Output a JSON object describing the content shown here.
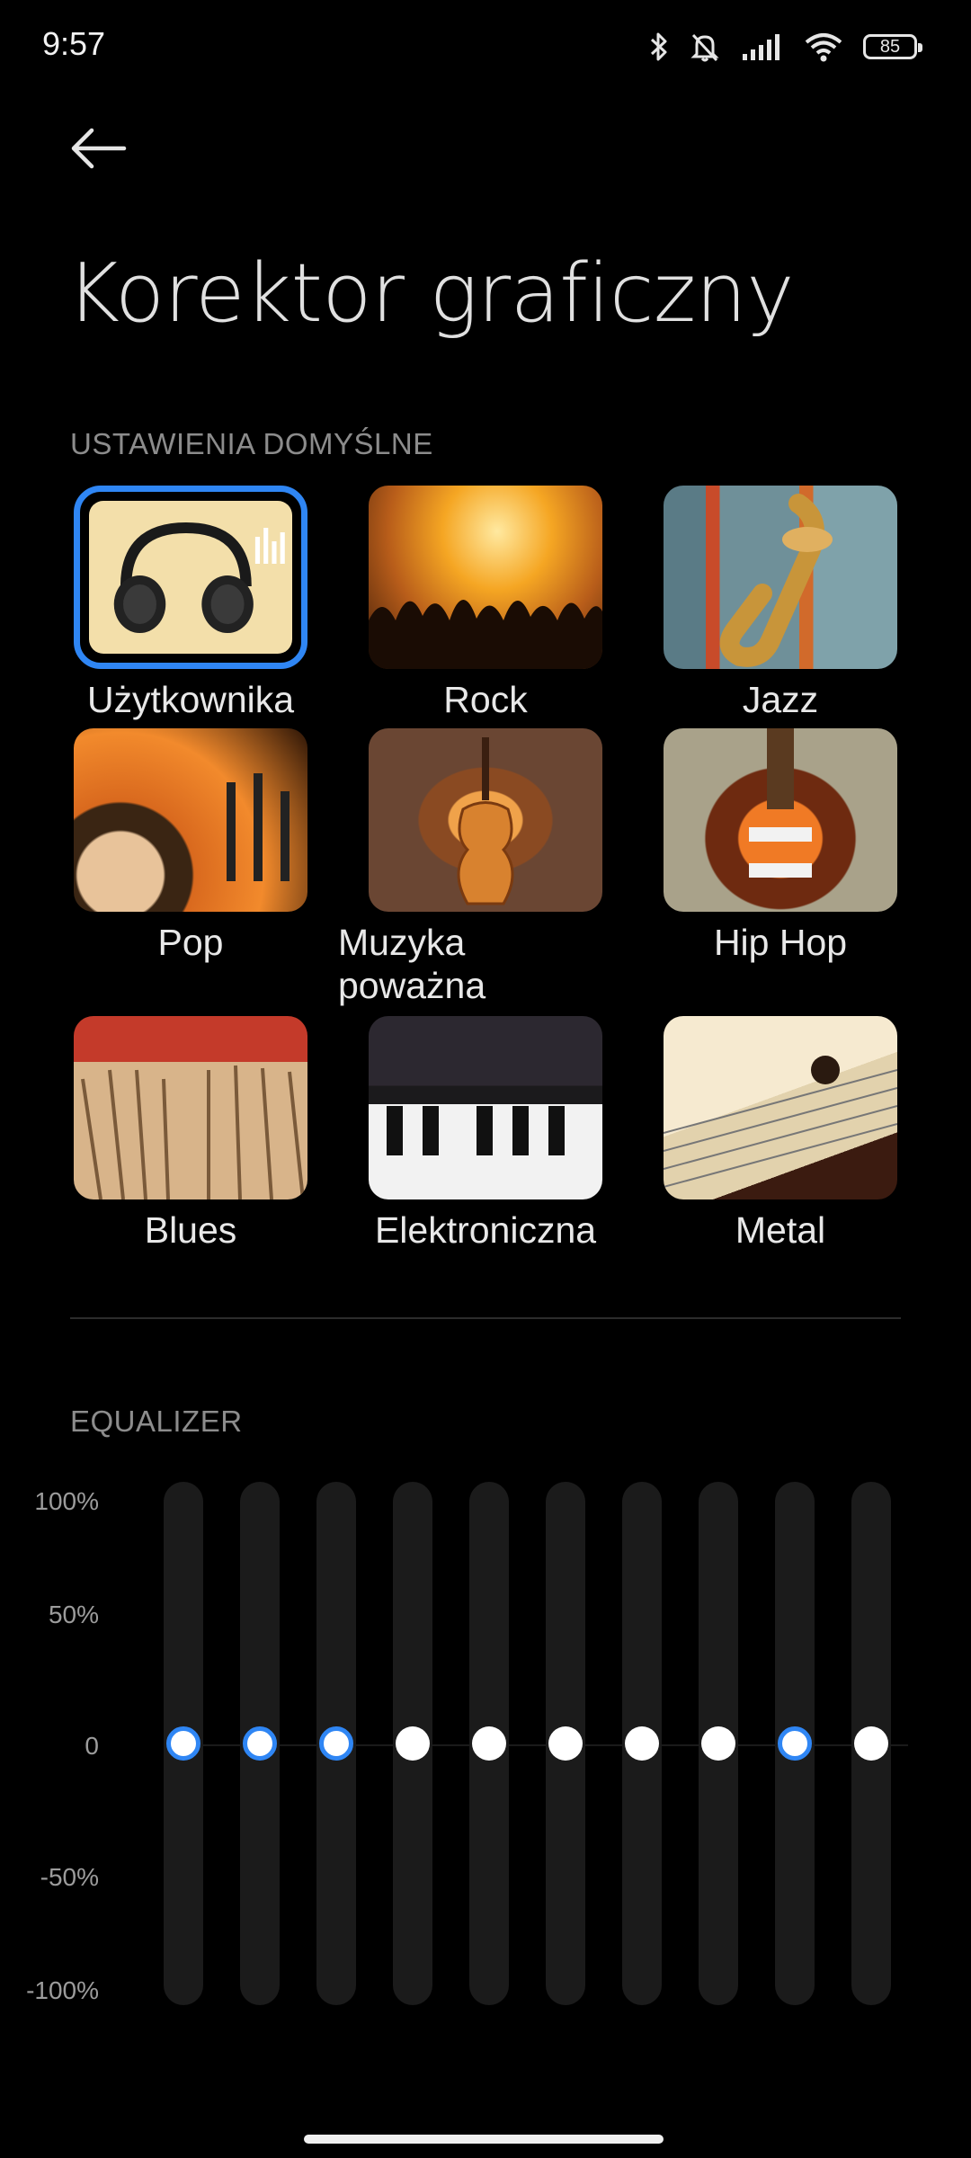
{
  "status_bar": {
    "time": "9:57",
    "battery": "85",
    "icons": [
      "bluetooth-icon",
      "bell-off-icon",
      "signal-icon",
      "wifi-icon",
      "battery-icon"
    ]
  },
  "header": {
    "back_icon": "arrow-left-icon",
    "title": "Korektor graficzny"
  },
  "presets": {
    "section_label": "USTAWIENIA DOMYŚLNE",
    "selected": "Użytkownika",
    "items": [
      {
        "label": "Użytkownika"
      },
      {
        "label": "Rock"
      },
      {
        "label": "Jazz"
      },
      {
        "label": "Pop"
      },
      {
        "label": "Muzyka poważna"
      },
      {
        "label": "Hip Hop"
      },
      {
        "label": "Blues"
      },
      {
        "label": "Elektroniczna"
      },
      {
        "label": "Metal"
      }
    ]
  },
  "equalizer": {
    "section_label": "EQUALIZER",
    "scale": [
      "100%",
      "50%",
      "0",
      "-50%",
      "-100%"
    ],
    "bands": [
      {
        "value": 0,
        "highlighted": true
      },
      {
        "value": 0,
        "highlighted": true
      },
      {
        "value": 0,
        "highlighted": true
      },
      {
        "value": 0,
        "highlighted": false
      },
      {
        "value": 0,
        "highlighted": false
      },
      {
        "value": 0,
        "highlighted": false
      },
      {
        "value": 0,
        "highlighted": false
      },
      {
        "value": 0,
        "highlighted": false
      },
      {
        "value": 0,
        "highlighted": true
      },
      {
        "value": 0,
        "highlighted": false
      }
    ],
    "accent_color": "#2f86f4"
  }
}
